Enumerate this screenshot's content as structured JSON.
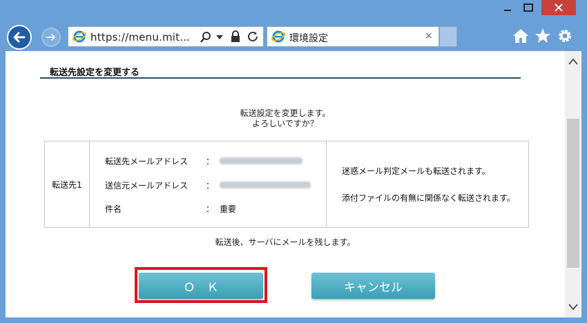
{
  "browser": {
    "address_text": "https://menu.mit...",
    "tab_title": "環境設定",
    "tab_close": "×"
  },
  "page": {
    "heading": "転送先設定を変更する",
    "confirm_line1": "転送設定を変更します。",
    "confirm_line2": "よろしいですか？",
    "table": {
      "row_label": "転送先1",
      "fields": [
        {
          "label": "転送先メールアドレス",
          "colon": "：",
          "value": "",
          "blurred": true
        },
        {
          "label": "送信元メールアドレス",
          "colon": "：",
          "value": "",
          "blurred": true
        },
        {
          "label": "件名",
          "colon": "：",
          "value": "重要",
          "blurred": false
        }
      ],
      "notes": [
        "迷惑メール判定メールも転送されます。",
        "添付ファイルの有無に関係なく転送されます。"
      ]
    },
    "footer_note": "転送後、サーバにメールを残します。",
    "ok_label": "Ｏ　Ｋ",
    "cancel_label": "キャンセル"
  },
  "colors": {
    "frame": "#6aa0d8",
    "button": "#3a9fb6",
    "highlight": "#e0141e",
    "heading_rule": "#2d4c68"
  }
}
